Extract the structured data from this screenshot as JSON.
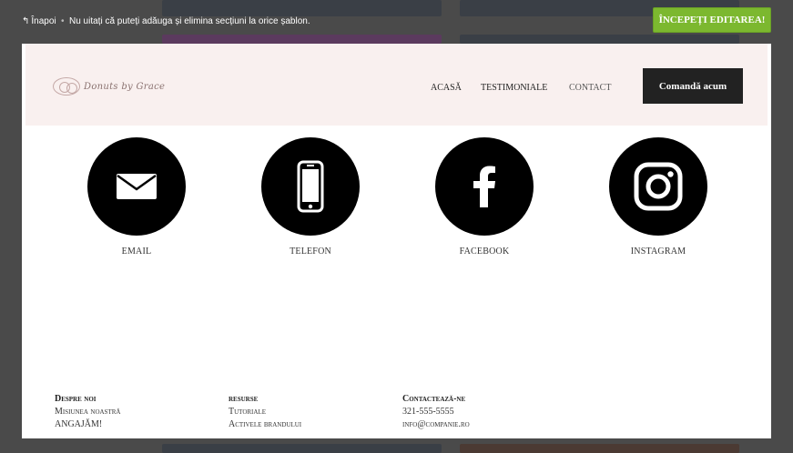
{
  "topbar": {
    "back_label": "Înapoi",
    "separator": "•",
    "notice": "Nu uitați că puteți adăuga și elimina secțiuni la orice șablon.",
    "start_button": "ÎNCEPEȚI EDITAREA!"
  },
  "site": {
    "logo_text": "Donuts by Grace",
    "nav": [
      "ACASĂ",
      "TESTIMONIALE",
      "CONTACT"
    ],
    "order_button": "Comandă acum",
    "contacts": [
      {
        "label": "EMAIL",
        "icon": "envelope-icon"
      },
      {
        "label": "TELEFON",
        "icon": "smartphone-icon"
      },
      {
        "label": "FACEBOOK",
        "icon": "facebook-icon"
      },
      {
        "label": "INSTAGRAM",
        "icon": "instagram-icon"
      }
    ],
    "footer": {
      "about": {
        "heading": "Despre noi",
        "links": [
          "Misiunea noastră",
          "ANGAJĂM!"
        ]
      },
      "resources": {
        "heading": "resurse",
        "links": [
          "Tutoriale",
          "Activele brandului"
        ]
      },
      "contact": {
        "heading": "Contactează-ne",
        "links": [
          "321-555-5555",
          "info@companie.ro"
        ]
      }
    }
  },
  "colors": {
    "accent_green": "#7cb82f",
    "header_bg": "#f9f0ef",
    "overlay": "#4a4a4a"
  }
}
